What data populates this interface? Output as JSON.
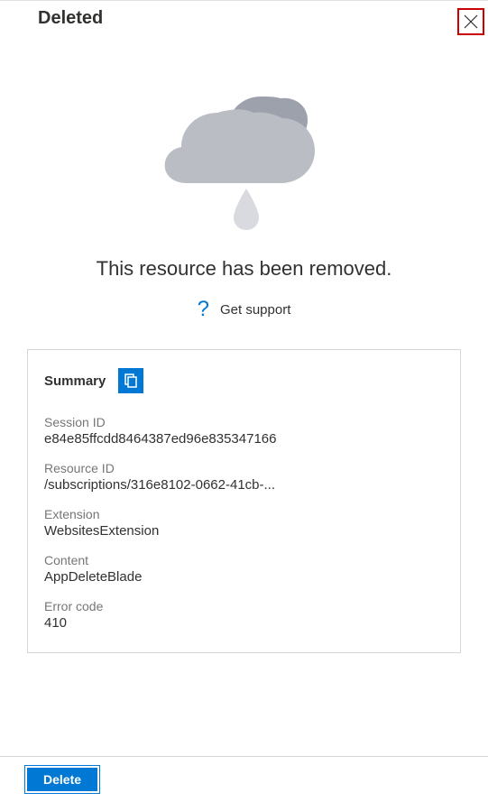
{
  "header": {
    "title": "Deleted"
  },
  "main": {
    "message": "This resource has been removed.",
    "support_link": "Get support"
  },
  "summary": {
    "title": "Summary",
    "fields": [
      {
        "label": "Session ID",
        "value": "e84e85ffcdd8464387ed96e835347166"
      },
      {
        "label": "Resource ID",
        "value": "/subscriptions/316e8102-0662-41cb-..."
      },
      {
        "label": "Extension",
        "value": "WebsitesExtension"
      },
      {
        "label": "Content",
        "value": "AppDeleteBlade"
      },
      {
        "label": "Error code",
        "value": "410"
      }
    ]
  },
  "footer": {
    "delete_label": "Delete"
  }
}
